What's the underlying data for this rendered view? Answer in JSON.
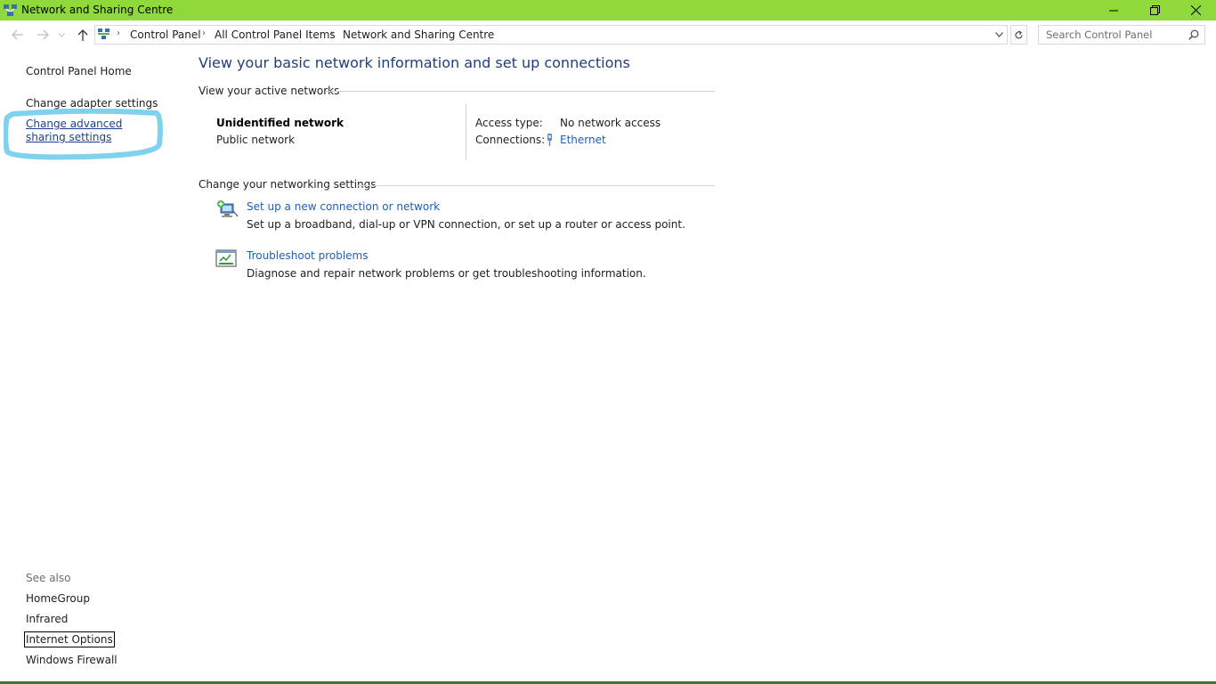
{
  "window": {
    "title": "Network and Sharing Centre",
    "accent_color": "#8fd93a"
  },
  "address_bar": {
    "breadcrumbs": [
      "Control Panel",
      "All Control Panel Items",
      "Network and Sharing Centre"
    ],
    "search_placeholder": "Search Control Panel"
  },
  "sidebar": {
    "home": "Control Panel Home",
    "adapter": "Change adapter settings",
    "advanced": "Change advanced sharing settings",
    "see_also_label": "See also",
    "see_also": [
      "HomeGroup",
      "Infrared",
      "Internet Options",
      "Windows Firewall"
    ]
  },
  "main": {
    "title": "View your basic network information and set up connections",
    "active_networks_heading": "View your active networks",
    "network": {
      "name": "Unidentified network",
      "category": "Public network",
      "access_type_label": "Access type:",
      "access_type_value": "No network access",
      "connections_label": "Connections:",
      "connections_value": "Ethernet"
    },
    "settings_heading": "Change your networking settings",
    "tasks": [
      {
        "title": "Set up a new connection or network",
        "description": "Set up a broadband, dial-up or VPN connection, or set up a router or access point.",
        "icon": "network-setup-icon"
      },
      {
        "title": "Troubleshoot problems",
        "description": "Diagnose and repair network problems or get troubleshooting information.",
        "icon": "troubleshoot-icon"
      }
    ]
  }
}
